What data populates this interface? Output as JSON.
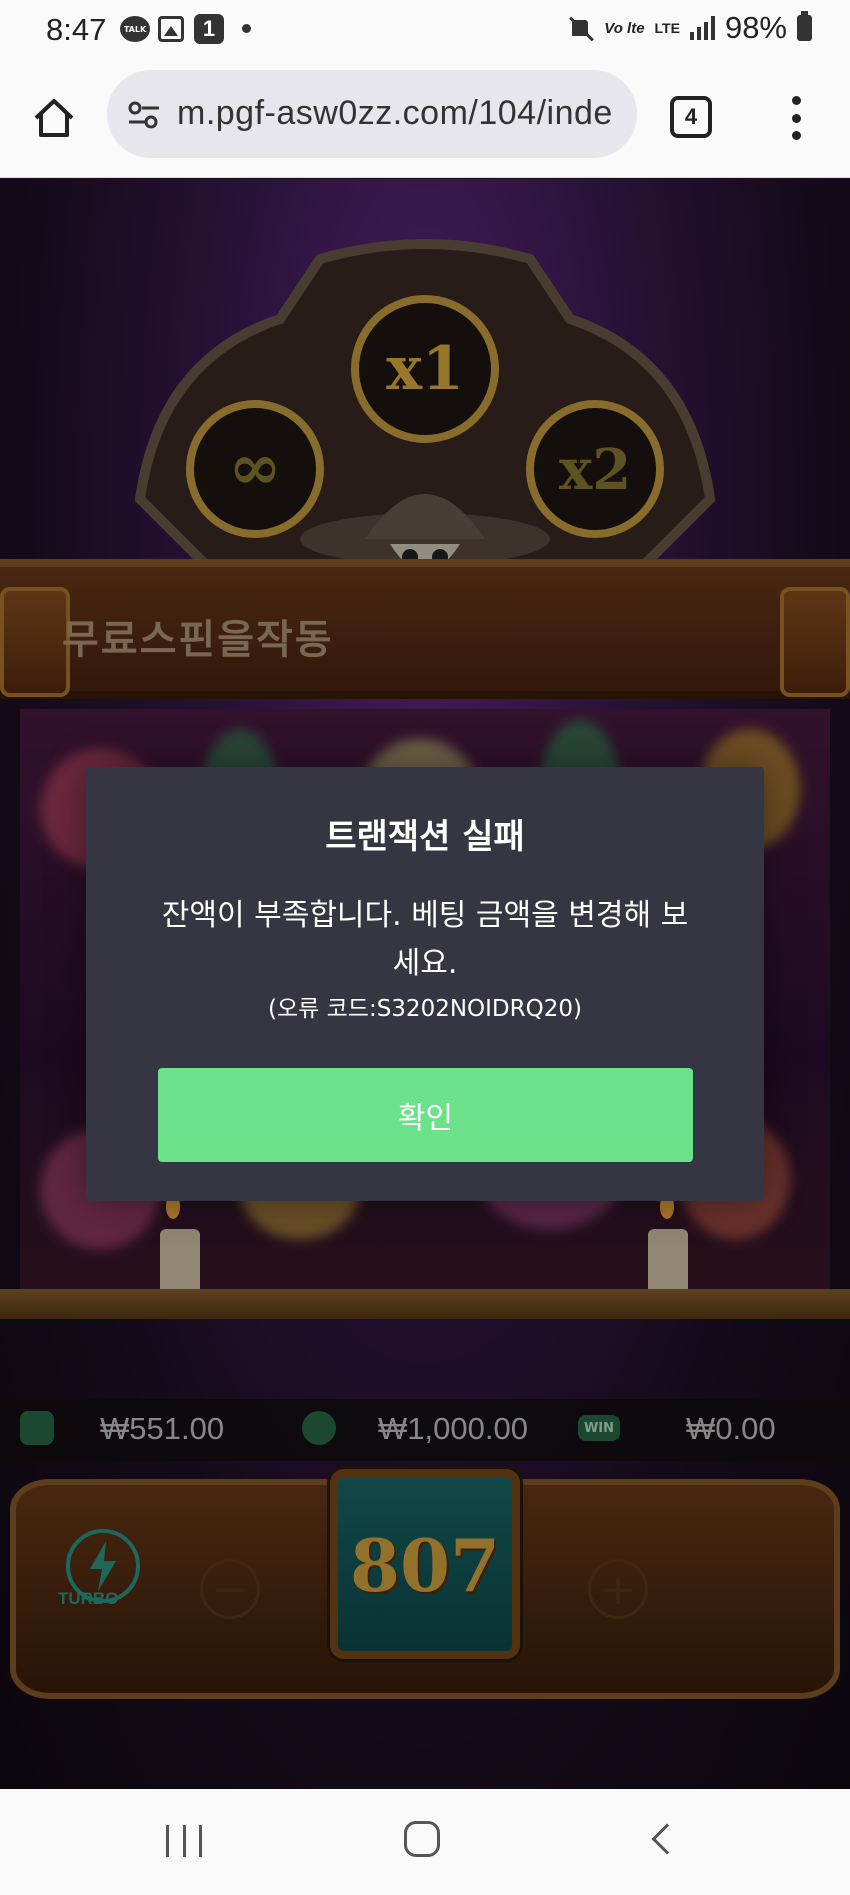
{
  "status_bar": {
    "time": "8:47",
    "talk_label": "TALK",
    "notification_count": "1",
    "volte": "Vo lte",
    "network": "LTE",
    "battery": "98%"
  },
  "browser": {
    "url": "m.pgf-asw0zz.com/104/inde",
    "tab_count": "4"
  },
  "game": {
    "banner_text": "무료스핀을작동",
    "multipliers": [
      "∞",
      "x1",
      "x2"
    ],
    "balance": "₩551.00",
    "bet": "₩1,000.00",
    "win": "₩0.00",
    "win_icon_label": "WIN",
    "spin_counter": "807",
    "turbo_label": "TURBO",
    "minus_label": "−",
    "plus_label": "+"
  },
  "dialog": {
    "title": "트랜잭션 실패",
    "message": "잔액이 부족합니다. 베팅 금액을 변경해 보세요.",
    "error_code": "(오류 코드:S3202NOIDRQ20)",
    "confirm_label": "확인",
    "confirm_color": "#6be28a",
    "background_color": "#363542"
  }
}
